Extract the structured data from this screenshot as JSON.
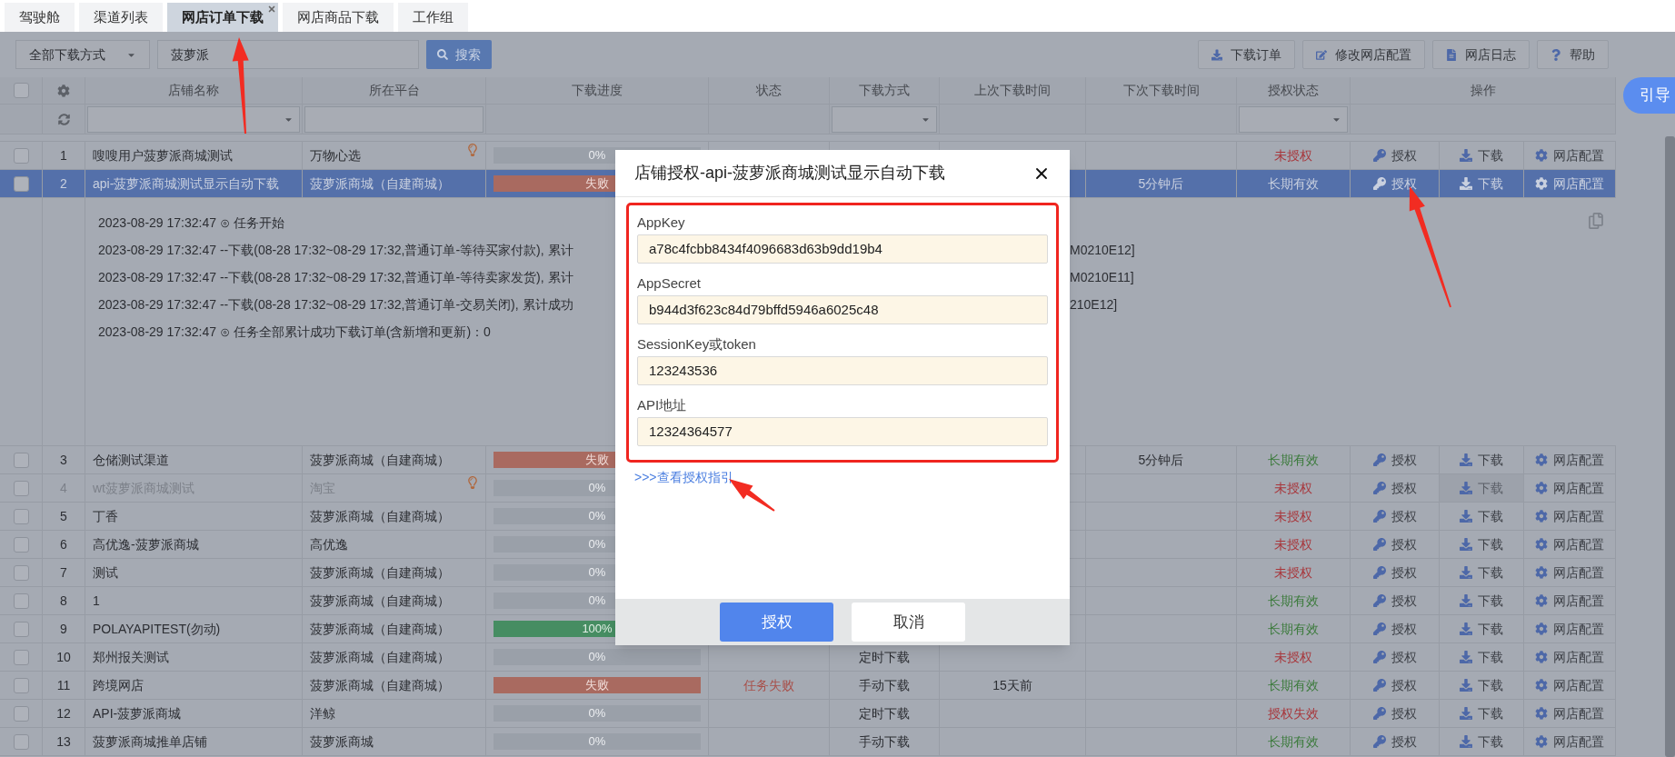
{
  "tabs": [
    {
      "label": "驾驶舱",
      "selected": false,
      "closable": false
    },
    {
      "label": "渠道列表",
      "selected": false,
      "closable": false
    },
    {
      "label": "网店订单下载",
      "selected": true,
      "closable": true
    },
    {
      "label": "网店商品下载",
      "selected": false,
      "closable": false
    },
    {
      "label": "工作组",
      "selected": false,
      "closable": false
    }
  ],
  "toolbar": {
    "mode_select": "全部下载方式",
    "search_field": {
      "value": "菠萝派"
    },
    "search_button": "搜索",
    "actions": [
      {
        "label": "下载订单"
      },
      {
        "label": "修改网店配置"
      },
      {
        "label": "网店日志"
      },
      {
        "label": "帮助"
      }
    ]
  },
  "guide_button": "引导",
  "table": {
    "header_checkbox": {
      "checked": false
    },
    "columns": [
      "店铺名称",
      "所在平台",
      "下载进度",
      "状态",
      "下载方式",
      "上次下载时间",
      "下次下载时间",
      "授权状态",
      "操作"
    ],
    "rows": [
      {
        "index": "1",
        "checked": false,
        "selected": false,
        "disabled": false,
        "name": "嗖嗖用户菠萝派商城测试",
        "platform": "万物心选",
        "hint": true,
        "progress": {
          "text": "0%",
          "kind": "idle"
        },
        "auth": {
          "text": "未授权",
          "kind": "bad"
        },
        "actions": [
          "授权",
          "下载",
          "网店配置"
        ]
      },
      {
        "index": "2",
        "checked": false,
        "selected": true,
        "disabled": false,
        "name": "api-菠萝派商城测试显示自动下载",
        "platform": "菠萝派商城（自建商城）",
        "hint": false,
        "progress": {
          "text": "失败",
          "kind": "failed"
        },
        "next": "5分钟后",
        "auth": {
          "text": "长期有效",
          "kind": "ok"
        },
        "actions": [
          "授权",
          "下载",
          "网店配置"
        ],
        "log": [
          {
            "text": "2023-08-29 17:32:47 ⊙ 任务开始"
          },
          {
            "text": "2023-08-29 17:32:47 --下载(08-28 17:32~08-29 17:32,普通订单-等待买家付款), 累计",
            "tail": "M0210E12]"
          },
          {
            "text": "2023-08-29 17:32:47 --下载(08-28 17:32~08-29 17:32,普通订单-等待卖家发货), 累计",
            "tail": "M0210E11]"
          },
          {
            "text": "2023-08-29 17:32:47 --下载(08-28 17:32~08-29 17:32,普通订单-交易关闭), 累计成功",
            "tail": "210E12]"
          },
          {
            "text": "2023-08-29 17:32:47 ⊙ 任务全部累计成功下载订单(含新增和更新)：0"
          }
        ]
      },
      {
        "index": "3",
        "checked": false,
        "selected": false,
        "disabled": false,
        "name": "仓储测试渠道",
        "platform": "菠萝派商城（自建商城）",
        "hint": false,
        "progress": {
          "text": "失败",
          "kind": "failed"
        },
        "next": "5分钟后",
        "auth": {
          "text": "长期有效",
          "kind": "ok"
        },
        "actions": [
          "授权",
          "下载",
          "网店配置"
        ]
      },
      {
        "index": "4",
        "checked": false,
        "selected": false,
        "disabled": true,
        "name": "wt菠萝派商城测试",
        "platform": "淘宝",
        "hint": true,
        "progress": {
          "text": "0%",
          "kind": "idle"
        },
        "auth": {
          "text": "未授权",
          "kind": "bad"
        },
        "actions": [
          "授权",
          "下载",
          "网店配置"
        ]
      },
      {
        "index": "5",
        "checked": false,
        "selected": false,
        "disabled": false,
        "name": "丁香",
        "platform": "菠萝派商城（自建商城）",
        "hint": false,
        "progress": {
          "text": "0%",
          "kind": "idle"
        },
        "auth": {
          "text": "未授权",
          "kind": "bad"
        },
        "actions": [
          "授权",
          "下载",
          "网店配置"
        ]
      },
      {
        "index": "6",
        "checked": false,
        "selected": false,
        "disabled": false,
        "name": "高优逸-菠萝派商城",
        "platform": "高优逸",
        "hint": false,
        "progress": {
          "text": "0%",
          "kind": "idle"
        },
        "auth": {
          "text": "未授权",
          "kind": "bad"
        },
        "actions": [
          "授权",
          "下载",
          "网店配置"
        ]
      },
      {
        "index": "7",
        "checked": false,
        "selected": false,
        "disabled": false,
        "name": "测试",
        "platform": "菠萝派商城（自建商城）",
        "hint": false,
        "progress": {
          "text": "0%",
          "kind": "idle"
        },
        "auth": {
          "text": "未授权",
          "kind": "bad"
        },
        "actions": [
          "授权",
          "下载",
          "网店配置"
        ]
      },
      {
        "index": "8",
        "checked": false,
        "selected": false,
        "disabled": false,
        "name": "1",
        "platform": "菠萝派商城（自建商城）",
        "hint": false,
        "progress": {
          "text": "0%",
          "kind": "idle"
        },
        "auth": {
          "text": "长期有效",
          "kind": "ok"
        },
        "actions": [
          "授权",
          "下载",
          "网店配置"
        ]
      },
      {
        "index": "9",
        "checked": false,
        "selected": false,
        "disabled": false,
        "name": "POLAYAPITEST(勿动)",
        "platform": "菠萝派商城（自建商城）",
        "hint": false,
        "progress": {
          "text": "100%",
          "kind": "done"
        },
        "auth": {
          "text": "长期有效",
          "kind": "ok"
        },
        "actions": [
          "授权",
          "下载",
          "网店配置"
        ]
      },
      {
        "index": "10",
        "checked": false,
        "selected": false,
        "disabled": false,
        "name": "郑州报关测试",
        "platform": "菠萝派商城（自建商城）",
        "hint": false,
        "progress": {
          "text": "0%",
          "kind": "idle"
        },
        "method": "定时下载",
        "auth": {
          "text": "未授权",
          "kind": "bad"
        },
        "actions": [
          "授权",
          "下载",
          "网店配置"
        ]
      },
      {
        "index": "11",
        "checked": false,
        "selected": false,
        "disabled": false,
        "name": "跨境网店",
        "platform": "菠萝派商城（自建商城）",
        "hint": false,
        "progress": {
          "text": "失败",
          "kind": "failed"
        },
        "status": "任务失败",
        "method": "手动下载",
        "last": "15天前",
        "auth": {
          "text": "长期有效",
          "kind": "ok"
        },
        "actions": [
          "授权",
          "下载",
          "网店配置"
        ]
      },
      {
        "index": "12",
        "checked": false,
        "selected": false,
        "disabled": false,
        "name": "API-菠萝派商城",
        "platform": "洋鲸",
        "hint": false,
        "progress": {
          "text": "0%",
          "kind": "idle"
        },
        "method": "定时下载",
        "auth": {
          "text": "授权失效",
          "kind": "bad"
        },
        "actions": [
          "授权",
          "下载",
          "网店配置"
        ]
      },
      {
        "index": "13",
        "checked": false,
        "selected": false,
        "disabled": false,
        "name": "菠萝派商城推单店铺",
        "platform": "菠萝派商城",
        "hint": false,
        "progress": {
          "text": "0%",
          "kind": "idle"
        },
        "method": "手动下载",
        "auth": {
          "text": "长期有效",
          "kind": "ok"
        },
        "actions": [
          "授权",
          "下载",
          "网店配置"
        ]
      }
    ]
  },
  "dialog": {
    "title": "店铺授权-api-菠萝派商城测试显示自动下载",
    "fields": [
      {
        "label": "AppKey",
        "value": "a78c4fcbb8434f4096683d63b9dd19b4"
      },
      {
        "label": "AppSecret",
        "value": "b944d3f623c84d79bffd5946a6025c48"
      },
      {
        "label": "SessionKey或token",
        "value": "123243536"
      },
      {
        "label": "API地址",
        "value": "12324364577"
      }
    ],
    "link": ">>>查看授权指引",
    "buttons": [
      {
        "label": "授权",
        "kind": "primary"
      },
      {
        "label": "取消",
        "kind": "secondary"
      }
    ]
  }
}
